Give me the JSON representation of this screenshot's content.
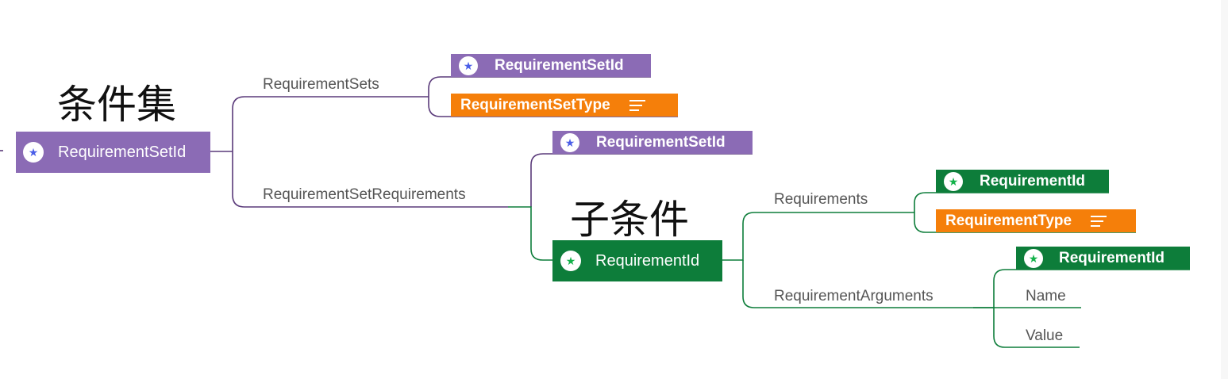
{
  "colors": {
    "set_purple": "#8b6bb5",
    "req_green": "#0d7d3a",
    "type_orange": "#f57f0a",
    "star_blue": "#4a5ee8",
    "star_green": "#13b24a",
    "line_purple": "#5a3a7a",
    "line_green": "#0d7d3a",
    "label_grey": "#555555"
  },
  "annotations": {
    "requirement_set_title": "条件集",
    "requirement_title": "子条件"
  },
  "root": {
    "label": "RequirementSetId",
    "icon": "star-icon"
  },
  "requirement_sets": {
    "label": "RequirementSets",
    "children": [
      {
        "label": "RequirementSetId",
        "icon": "star-icon"
      },
      {
        "label": "RequirementSetType",
        "icon": "note-icon"
      }
    ]
  },
  "requirement_set_requirements": {
    "label": "RequirementSetRequirements",
    "children": [
      {
        "label": "RequirementSetId",
        "icon": "star-icon"
      },
      {
        "label": "RequirementId",
        "icon": "star-icon"
      }
    ]
  },
  "requirements": {
    "label": "Requirements",
    "children": [
      {
        "label": "RequirementId",
        "icon": "star-icon"
      },
      {
        "label": "RequirementType",
        "icon": "note-icon"
      }
    ]
  },
  "requirement_arguments": {
    "label": "RequirementArguments",
    "children": [
      {
        "label": "RequirementId",
        "icon": "star-icon"
      },
      {
        "label": "Name"
      },
      {
        "label": "Value"
      }
    ]
  }
}
